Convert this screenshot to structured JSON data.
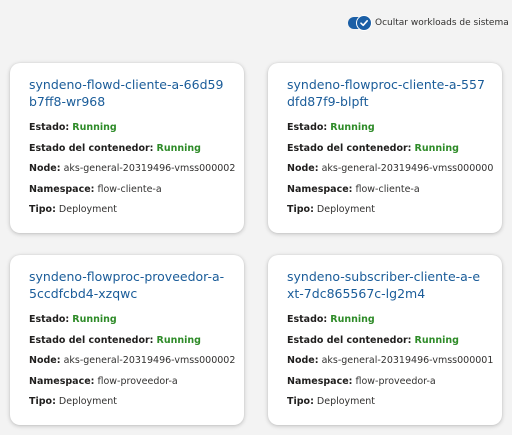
{
  "toggle": {
    "label": "Ocultar workloads de sistema",
    "checked": true
  },
  "labels": {
    "estado": "Estado:",
    "estado_contenedor": "Estado del contenedor:",
    "node": "Node:",
    "namespace": "Namespace:",
    "tipo": "Tipo:"
  },
  "cards": [
    {
      "title": "syndeno-flowd-cliente-a-66d59b7ff8-wr968",
      "estado": "Running",
      "estado_contenedor": "Running",
      "node": "aks-general-20319496-vmss000002",
      "namespace": "flow-cliente-a",
      "tipo": "Deployment"
    },
    {
      "title": "syndeno-flowproc-cliente-a-557dfd87f9-blpft",
      "estado": "Running",
      "estado_contenedor": "Running",
      "node": "aks-general-20319496-vmss000000",
      "namespace": "flow-cliente-a",
      "tipo": "Deployment"
    },
    {
      "title": "syndeno-flowproc-proveedor-a-5ccdfcbd4-xzqwc",
      "estado": "Running",
      "estado_contenedor": "Running",
      "node": "aks-general-20319496-vmss000002",
      "namespace": "flow-proveedor-a",
      "tipo": "Deployment"
    },
    {
      "title": "syndeno-subscriber-cliente-a-ext-7dc865567c-lg2m4",
      "estado": "Running",
      "estado_contenedor": "Running",
      "node": "aks-general-20319496-vmss000001",
      "namespace": "flow-proveedor-a",
      "tipo": "Deployment"
    }
  ]
}
